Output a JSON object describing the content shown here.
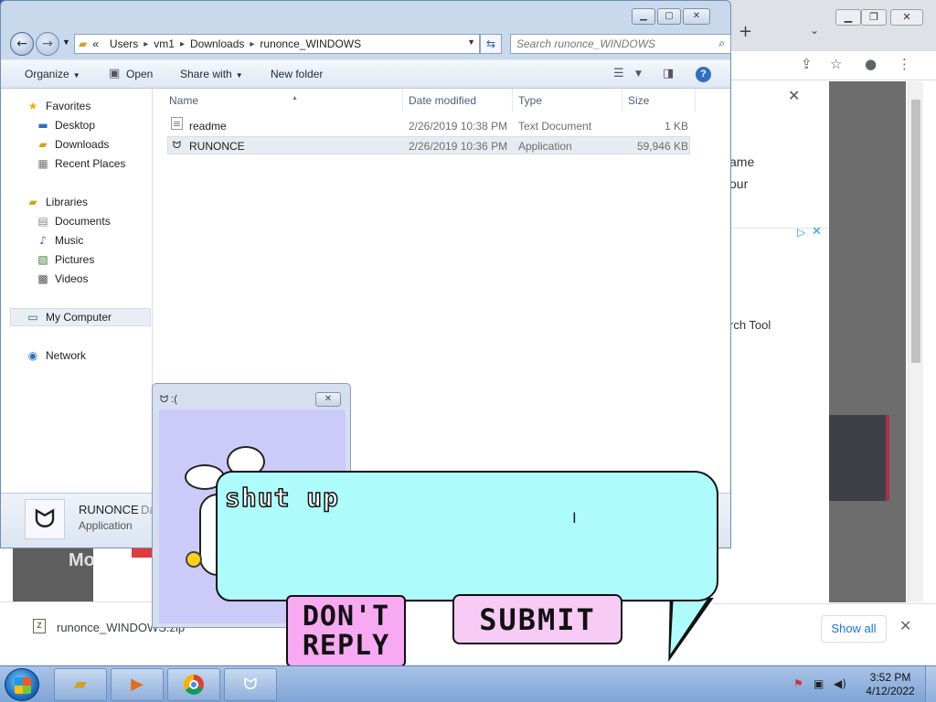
{
  "explorer": {
    "breadcrumb": [
      "Users",
      "vm1",
      "Downloads",
      "runonce_WINDOWS"
    ],
    "breadcrumb_lead": "«",
    "search_placeholder": "Search runonce_WINDOWS",
    "toolbar": {
      "organize": "Organize",
      "open": "Open",
      "share_with": "Share with",
      "new_folder": "New folder"
    },
    "nav": {
      "favorites": "Favorites",
      "desktop": "Desktop",
      "downloads": "Downloads",
      "recent_places": "Recent Places",
      "libraries": "Libraries",
      "documents": "Documents",
      "music": "Music",
      "pictures": "Pictures",
      "videos": "Videos",
      "my_computer": "My Computer",
      "network": "Network"
    },
    "columns": {
      "name": "Name",
      "date_modified": "Date modified",
      "type": "Type",
      "size": "Size"
    },
    "files": [
      {
        "name": "readme",
        "date": "2/26/2019 10:38 PM",
        "type": "Text Document",
        "size": "1 KB"
      },
      {
        "name": "RUNONCE",
        "date": "2/26/2019 10:36 PM",
        "type": "Application",
        "size": "59,946 KB"
      }
    ],
    "details": {
      "name": "RUNONCE",
      "name_suffix": "Da",
      "type": "Application"
    }
  },
  "sad_window": {
    "title": ":(",
    "input_value": "shut up",
    "dont_reply_line1": "DON'T",
    "dont_reply_line2": "REPLY",
    "submit": "SUBMIT"
  },
  "chrome": {
    "new_tab": "+",
    "page_text": {
      "line1": "ame",
      "line2": "our",
      "line3": "rch Tool",
      "mo": "Mo"
    },
    "download_file": "runonce_WINDOWS.zip",
    "show_all": "Show all"
  },
  "taskbar": {
    "time": "3:52 PM",
    "date": "4/12/2022"
  },
  "colors": {
    "bubble": "#aefbfb",
    "dont_reply_bg": "#f7a9f2",
    "submit_bg": "#f8cbf6",
    "sad_client": "#cccaf8"
  }
}
